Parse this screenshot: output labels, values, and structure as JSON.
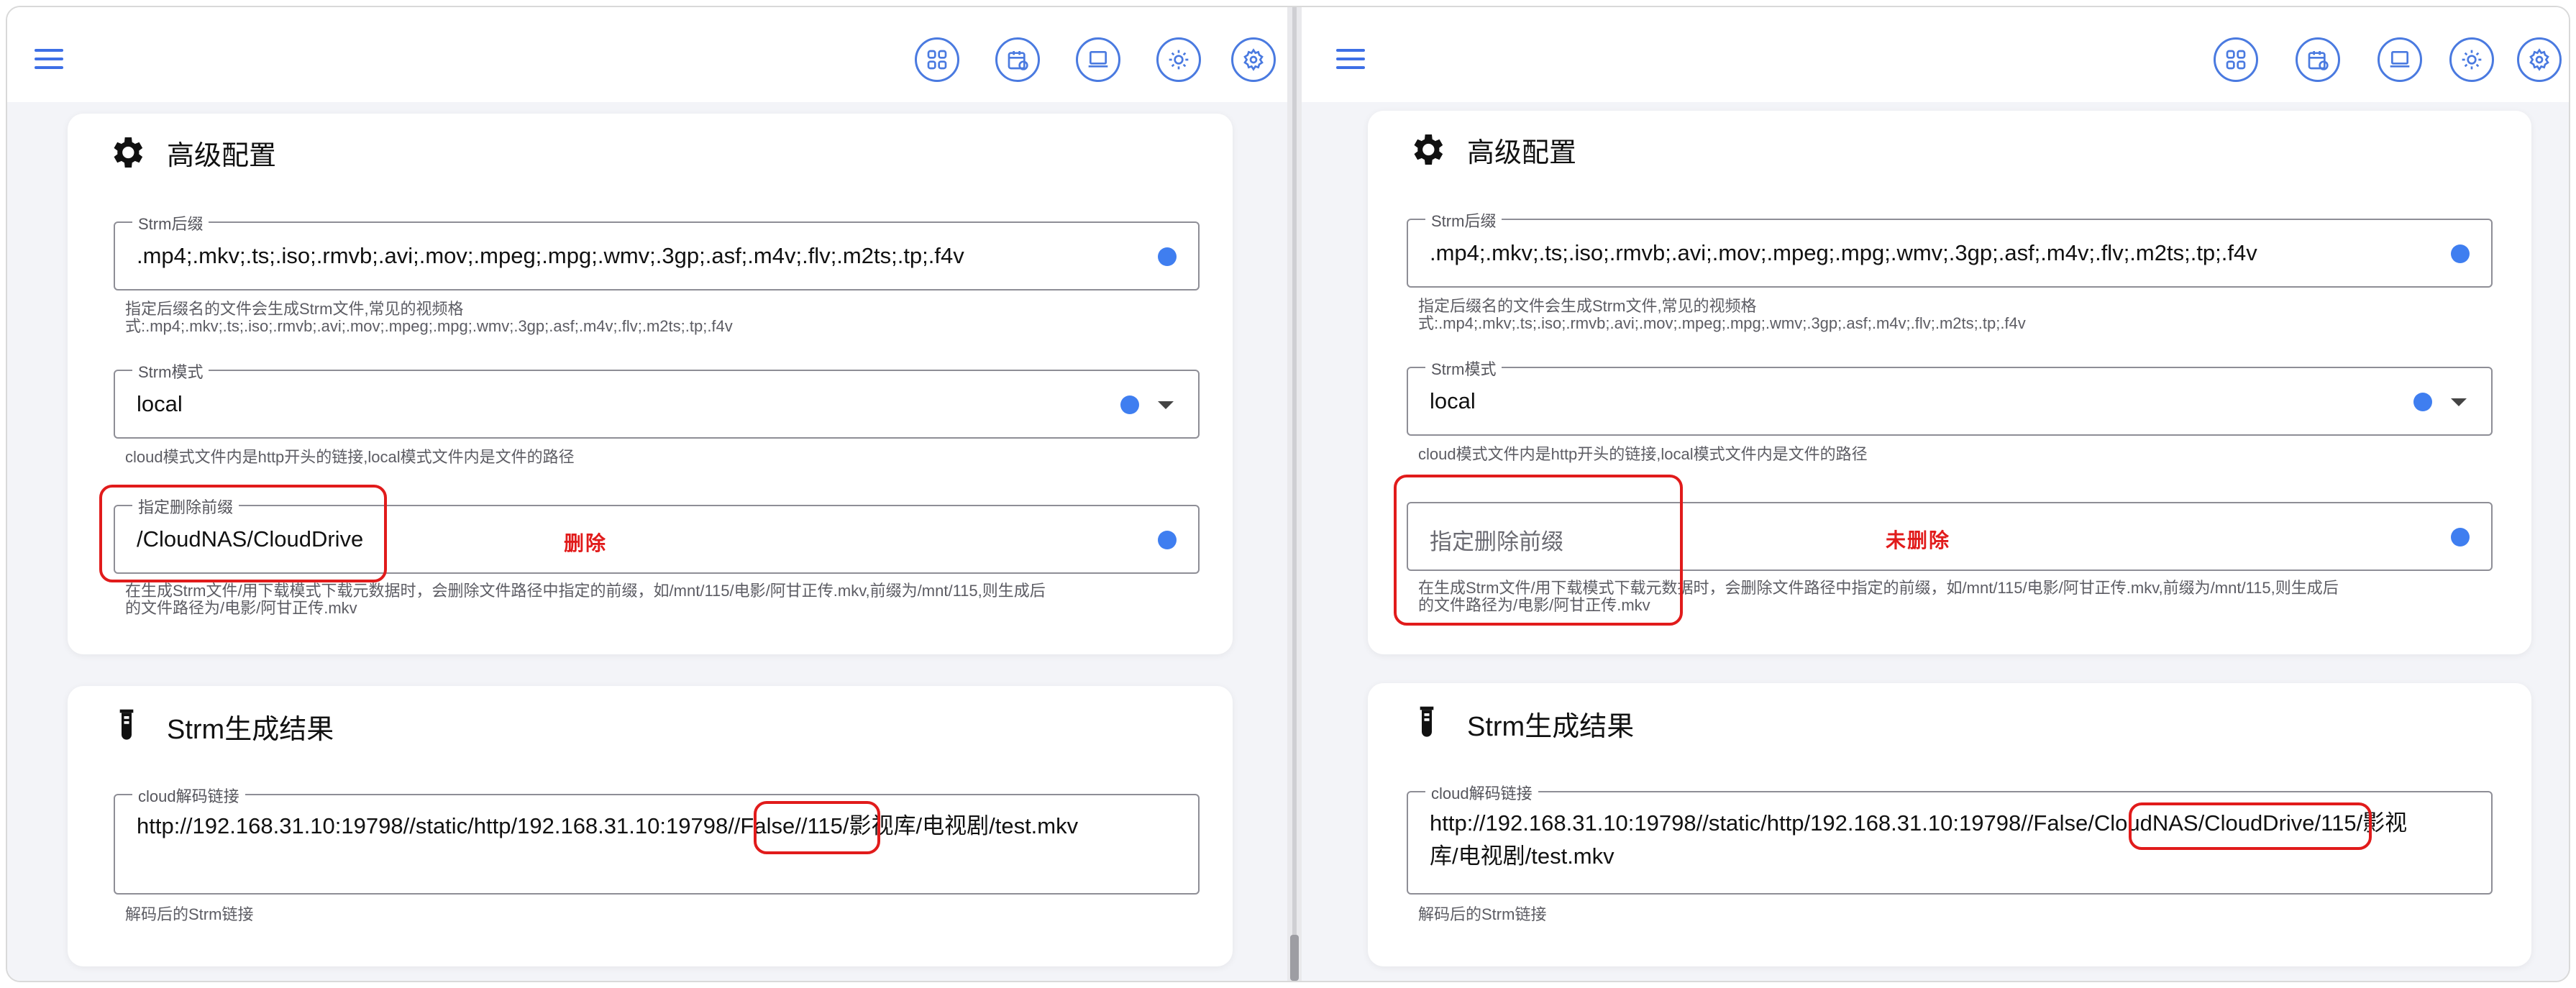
{
  "left": {
    "toolbar": {
      "menu": "menu-icon",
      "icons": [
        "grid-icon",
        "calendar-icon",
        "monitor-icon",
        "sun-icon",
        "gear-icon"
      ]
    },
    "advanced": {
      "title": "高级配置",
      "suffix_label": "Strm后缀",
      "suffix_value": ".mp4;.mkv;.ts;.iso;.rmvb;.avi;.mov;.mpeg;.mpg;.wmv;.3gp;.asf;.m4v;.flv;.m2ts;.tp;.f4v",
      "suffix_hint_1": "指定后缀名的文件会生成Strm文件,常见的视频格",
      "suffix_hint_2": "式:.mp4;.mkv;.ts;.iso;.rmvb;.avi;.mov;.mpeg;.mpg;.wmv;.3gp;.asf;.m4v;.flv;.m2ts;.tp;.f4v",
      "mode_label": "Strm模式",
      "mode_value": "local",
      "mode_hint": "cloud模式文件内是http开头的链接,local模式文件内是文件的路径",
      "prefix_label": "指定删除前缀",
      "prefix_value": "/CloudNAS/CloudDrive",
      "prefix_hint_1": "在生成Strm文件/用下载模式下载元数据时，会删除文件路径中指定的前缀，如/mnt/115/电影/阿甘正传.mkv,前缀为/mnt/115,则生成后",
      "prefix_hint_2": "的文件路径为/电影/阿甘正传.mkv",
      "note": "删除"
    },
    "result": {
      "title": "Strm生成结果",
      "link_label": "cloud解码链接",
      "link_part1": "http://192.168.31.10:19798//static/http/192.168.31.10:19798",
      "link_part2": "//False//115",
      "link_part3": "/影视库/电视剧/test.mkv",
      "link_hint": "解码后的Strm链接"
    }
  },
  "right": {
    "toolbar": {
      "menu": "menu-icon",
      "icons": [
        "grid-icon",
        "calendar-icon",
        "monitor-icon",
        "sun-icon",
        "gear-icon"
      ]
    },
    "advanced": {
      "title": "高级配置",
      "suffix_label": "Strm后缀",
      "suffix_value": ".mp4;.mkv;.ts;.iso;.rmvb;.avi;.mov;.mpeg;.mpg;.wmv;.3gp;.asf;.m4v;.flv;.m2ts;.tp;.f4v",
      "suffix_hint_1": "指定后缀名的文件会生成Strm文件,常见的视频格",
      "suffix_hint_2": "式:.mp4;.mkv;.ts;.iso;.rmvb;.avi;.mov;.mpeg;.mpg;.wmv;.3gp;.asf;.m4v;.flv;.m2ts;.tp;.f4v",
      "mode_label": "Strm模式",
      "mode_value": "local",
      "mode_hint": "cloud模式文件内是http开头的链接,local模式文件内是文件的路径",
      "prefix_placeholder": "指定删除前缀",
      "prefix_hint_1": "在生成Strm文件/用下载模式下载元数据时，会删除文件路径中指定的前缀，如/mnt/115/电影/阿甘正传.mkv,前缀为/mnt/115,则生成后",
      "prefix_hint_2": "的文件路径为/电影/阿甘正传.mkv",
      "note": "未删除"
    },
    "result": {
      "title": "Strm生成结果",
      "link_label": "cloud解码链接",
      "link_part1": "http://192.168.31.10:19798//static/http/192.168.31.10:19798//False",
      "link_part2": "/CloudNAS/CloudDrive",
      "link_part3": "/115/影视",
      "link_line2": "库/电视剧/test.mkv",
      "link_hint": "解码后的Strm链接"
    }
  },
  "colors": {
    "accent": "#3f7ef0",
    "annotation": "#e11b1b"
  }
}
